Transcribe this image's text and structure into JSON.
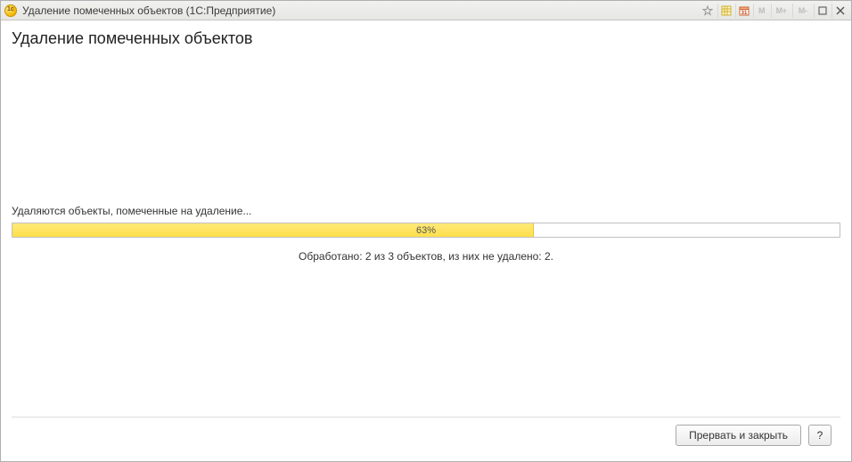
{
  "titlebar": {
    "title": "Удаление помеченных объектов  (1С:Предприятие)"
  },
  "page": {
    "heading": "Удаление помеченных объектов"
  },
  "progress": {
    "label": "Удаляются объекты, помеченные на удаление...",
    "percent": 63,
    "percent_text": "63%",
    "detail": "Обработано: 2 из 3 объектов, из них не удалено: 2."
  },
  "footer": {
    "cancel_label": "Прервать и закрыть",
    "help_label": "?"
  }
}
